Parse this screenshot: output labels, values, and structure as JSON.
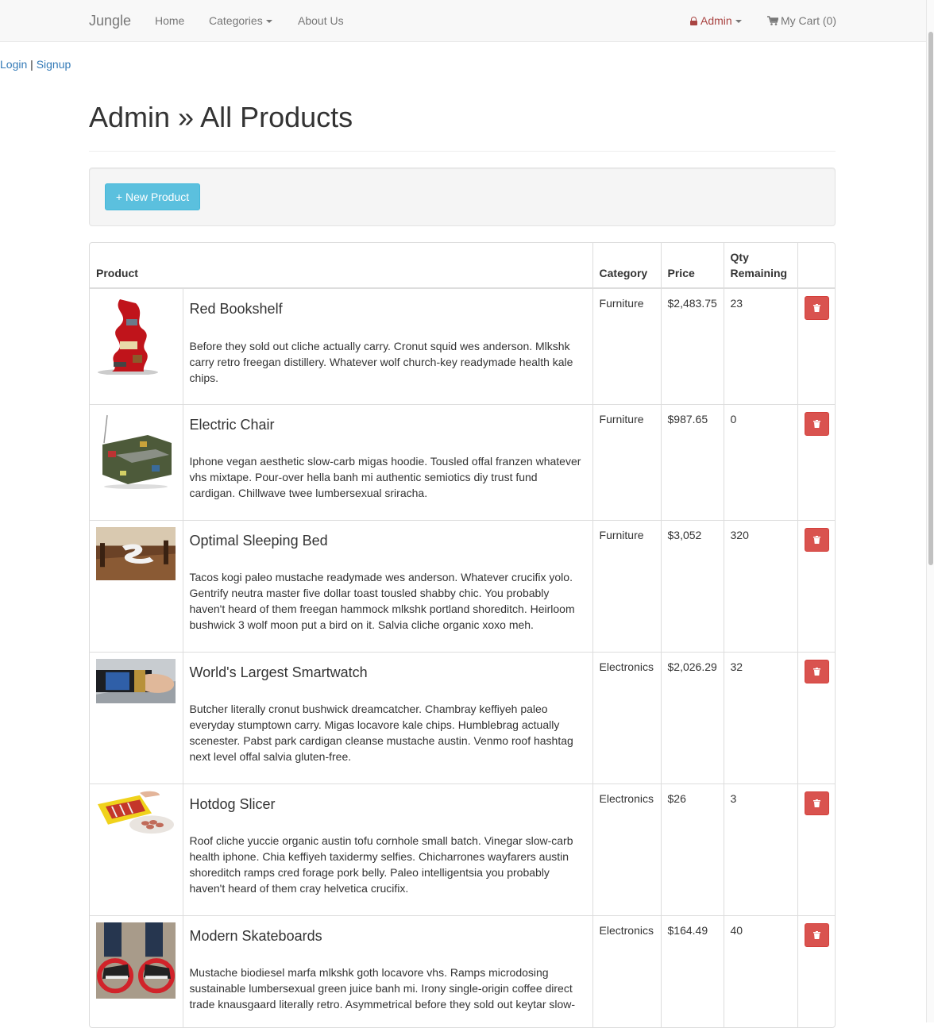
{
  "navbar": {
    "brand": "Jungle",
    "home": "Home",
    "categories": "Categories",
    "about": "About Us",
    "admin": "Admin",
    "cart": "My Cart (0)"
  },
  "auth": {
    "login": "Login",
    "separator": "|",
    "signup": "Signup"
  },
  "page": {
    "title": "Admin » All Products",
    "new_product_label": "+ New Product"
  },
  "table": {
    "headers": {
      "product": "Product",
      "category": "Category",
      "price": "Price",
      "qty_line1": "Qty",
      "qty_line2": "Remaining"
    },
    "rows": [
      {
        "name": "Red Bookshelf",
        "description": "Before they sold out cliche actually carry. Cronut squid wes anderson. Mlkshk carry retro freegan distillery. Whatever wolf church-key readymade health kale chips.",
        "category": "Furniture",
        "price": "$2,483.75",
        "qty": "23",
        "image": "red-bookshelf-image"
      },
      {
        "name": "Electric Chair",
        "description": "Iphone vegan aesthetic slow-carb migas hoodie. Tousled offal franzen whatever vhs mixtape. Pour-over hella banh mi authentic semiotics diy trust fund cardigan. Chillwave twee lumbersexual sriracha.",
        "category": "Furniture",
        "price": "$987.65",
        "qty": "0",
        "image": "electric-chair-image"
      },
      {
        "name": "Optimal Sleeping Bed",
        "description": "Tacos kogi paleo mustache readymade wes anderson. Whatever crucifix yolo. Gentrify neutra master five dollar toast tousled shabby chic. You probably haven't heard of them freegan hammock mlkshk portland shoreditch. Heirloom bushwick 3 wolf moon put a bird on it. Salvia cliche organic xoxo meh.",
        "category": "Furniture",
        "price": "$3,052",
        "qty": "320",
        "image": "sleeping-bed-image"
      },
      {
        "name": "World's Largest Smartwatch",
        "description": "Butcher literally cronut bushwick dreamcatcher. Chambray keffiyeh paleo everyday stumptown carry. Migas locavore kale chips. Humblebrag actually scenester. Pabst park cardigan cleanse mustache austin. Venmo roof hashtag next level offal salvia gluten-free.",
        "category": "Electronics",
        "price": "$2,026.29",
        "qty": "32",
        "image": "smartwatch-image"
      },
      {
        "name": "Hotdog Slicer",
        "description": "Roof cliche yuccie organic austin tofu cornhole small batch. Vinegar slow-carb health iphone. Chia keffiyeh taxidermy selfies. Chicharrones wayfarers austin shoreditch ramps cred forage pork belly. Paleo intelligentsia you probably haven't heard of them cray helvetica crucifix.",
        "category": "Electronics",
        "price": "$26",
        "qty": "3",
        "image": "hotdog-slicer-image"
      },
      {
        "name": "Modern Skateboards",
        "description": "Mustache biodiesel marfa mlkshk goth locavore vhs. Ramps microdosing sustainable lumbersexual green juice banh mi. Irony single-origin coffee direct trade knausgaard literally retro. Asymmetrical before they sold out keytar slow-",
        "category": "Electronics",
        "price": "$164.49",
        "qty": "40",
        "image": "skateboards-image"
      }
    ]
  }
}
